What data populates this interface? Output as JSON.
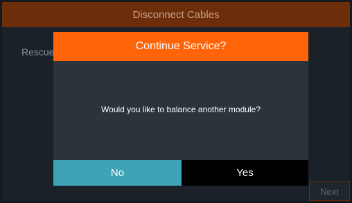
{
  "header": {
    "title": "Disconnect Cables"
  },
  "background": {
    "label": "Rescue",
    "next_label": "Next"
  },
  "dialog": {
    "title": "Continue Service?",
    "message": "Would you like to balance another module?",
    "no_label": "No",
    "yes_label": "Yes"
  },
  "colors": {
    "header_bg": "#6b2d0a",
    "dialog_title_bg": "#ff6409",
    "dialog_body_bg": "#2b333b",
    "no_button_bg": "#3ea3b6",
    "yes_button_bg": "#000000"
  }
}
